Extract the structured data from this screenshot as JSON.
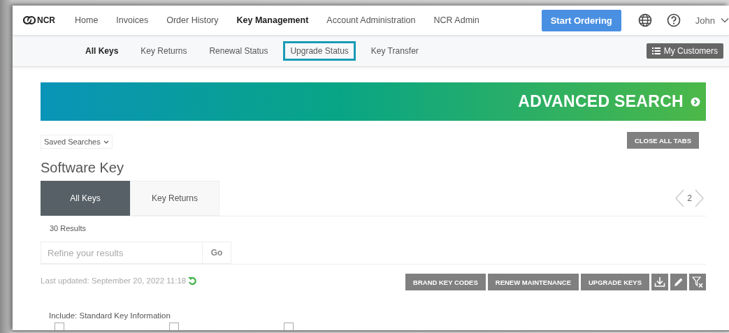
{
  "top_nav": {
    "logo": "NCR",
    "items": [
      {
        "label": "Home",
        "selected": false
      },
      {
        "label": "Invoices",
        "selected": false
      },
      {
        "label": "Order History",
        "selected": false
      },
      {
        "label": "Key Management",
        "selected": true
      },
      {
        "label": "Account Administration",
        "selected": false
      },
      {
        "label": "NCR Admin",
        "selected": false
      }
    ],
    "start_button": "Start Ordering",
    "user": "John"
  },
  "sub_nav": {
    "items": [
      {
        "label": "All Keys",
        "selected": true,
        "highlighted": false
      },
      {
        "label": "Key Returns",
        "selected": false,
        "highlighted": false
      },
      {
        "label": "Renewal Status",
        "selected": false,
        "highlighted": false
      },
      {
        "label": "Upgrade Status",
        "selected": false,
        "highlighted": true
      },
      {
        "label": "Key Transfer",
        "selected": false,
        "highlighted": false
      }
    ],
    "customers_button": "My Customers"
  },
  "banner": {
    "label": "ADVANCED SEARCH"
  },
  "saved_searches": "Saved Searches",
  "close_tabs_button": "CLOSE ALL TABS",
  "section_title": "Software Key",
  "tabs": [
    {
      "label": "All Keys",
      "selected": true
    },
    {
      "label": "Key Returns",
      "selected": false
    }
  ],
  "pager": {
    "page": "2"
  },
  "results_count": "30 Results",
  "refine": {
    "placeholder": "Refine your results",
    "button": "Go"
  },
  "last_updated": "Last updated: September 20, 2022 11:18",
  "actions": [
    "BRAND KEY CODES",
    "RENEW MAINTENANCE",
    "UPGRADE KEYS"
  ],
  "include_label": "Include: Standard Key Information",
  "include_options": [
    {
      "checked": false
    },
    {
      "checked": false
    },
    {
      "checked": false
    }
  ]
}
